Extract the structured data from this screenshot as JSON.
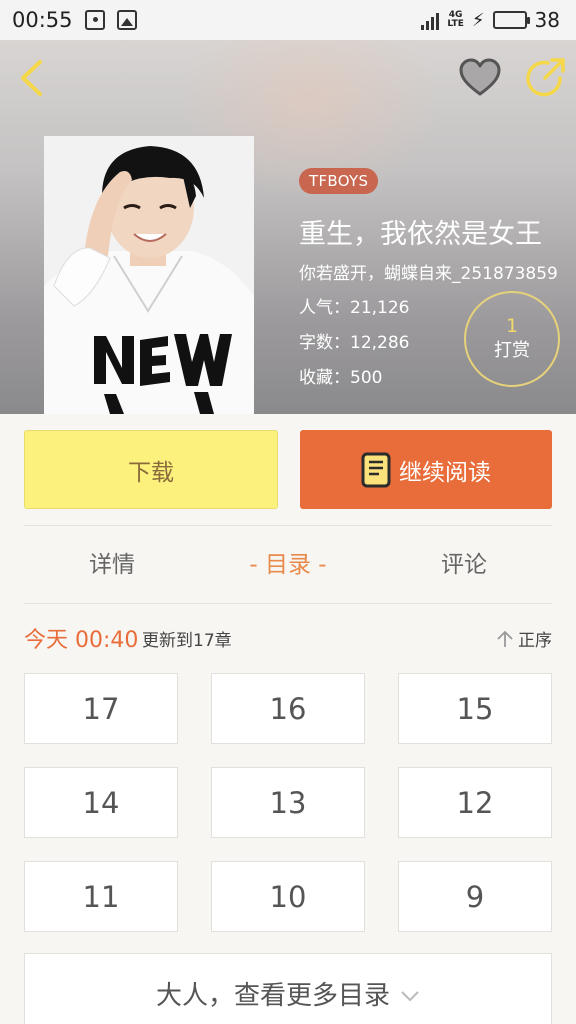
{
  "status_bar": {
    "time": "00:55",
    "network": "4G LTE",
    "battery_level": "38",
    "battery_color": "#22bb22"
  },
  "header": {
    "back_icon": "chevron-left-icon",
    "favorite_icon": "heart-icon",
    "share_icon": "share-icon",
    "icon_color": "#f5d84a"
  },
  "book": {
    "tag": "TFBOYS",
    "title": "重生，我依然是女王",
    "author": "你若盛开，蝴蝶自来_251873859",
    "stats": [
      {
        "label": "人气：",
        "value": "21,126"
      },
      {
        "label": "字数：",
        "value": "12,286"
      },
      {
        "label": "收藏：",
        "value": "500"
      }
    ],
    "reward": {
      "count": "1",
      "label": "打赏"
    }
  },
  "actions": {
    "download_label": "下载",
    "continue_label": "继续阅读"
  },
  "tabs": [
    {
      "label": "详情",
      "active": false
    },
    {
      "label": "- 目录 -",
      "active": true
    },
    {
      "label": "评论",
      "active": false
    }
  ],
  "update": {
    "today": "今天 00:40",
    "text": "更新到17章",
    "sort_label": "正序"
  },
  "chapters": [
    "17",
    "16",
    "15",
    "14",
    "13",
    "12",
    "11",
    "10",
    "9"
  ],
  "more_label": "大人，查看更多目录",
  "colors": {
    "accent": "#e86d3a",
    "download_bg": "#fbf17c",
    "tag_bg": "#c8664f"
  }
}
